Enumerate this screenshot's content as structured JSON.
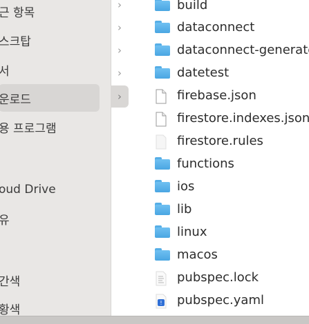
{
  "sidebar": {
    "items": [
      {
        "label": "근 항목"
      },
      {
        "label": "스크탑"
      },
      {
        "label": "서"
      },
      {
        "label": "운로드"
      },
      {
        "label": "용 프로그램"
      },
      {
        "label": "oud Drive"
      },
      {
        "label": "유"
      },
      {
        "label": "간색"
      },
      {
        "label": "황색"
      }
    ]
  },
  "files": [
    {
      "name": "build",
      "icon": "folder-icon"
    },
    {
      "name": "dataconnect",
      "icon": "folder-icon"
    },
    {
      "name": "dataconnect-generated",
      "icon": "folder-icon"
    },
    {
      "name": "datetest",
      "icon": "folder-icon"
    },
    {
      "name": "firebase.json",
      "icon": "document-icon"
    },
    {
      "name": "firestore.indexes.json",
      "icon": "document-icon"
    },
    {
      "name": "firestore.rules",
      "icon": "blank-document-icon"
    },
    {
      "name": "functions",
      "icon": "folder-icon"
    },
    {
      "name": "ios",
      "icon": "folder-icon"
    },
    {
      "name": "lib",
      "icon": "folder-icon"
    },
    {
      "name": "linux",
      "icon": "folder-icon"
    },
    {
      "name": "macos",
      "icon": "folder-icon"
    },
    {
      "name": "pubspec.lock",
      "icon": "text-document-icon"
    },
    {
      "name": "pubspec.yaml",
      "icon": "yaml-document-icon"
    }
  ],
  "chevrons": [
    "›",
    "›",
    "›",
    "›",
    "›"
  ],
  "colors": {
    "sidebar_bg": "#e9e7e5",
    "selected_bg": "#d8d6d4",
    "folder_blue": "#56aee6",
    "text": "#2c2c2c"
  }
}
